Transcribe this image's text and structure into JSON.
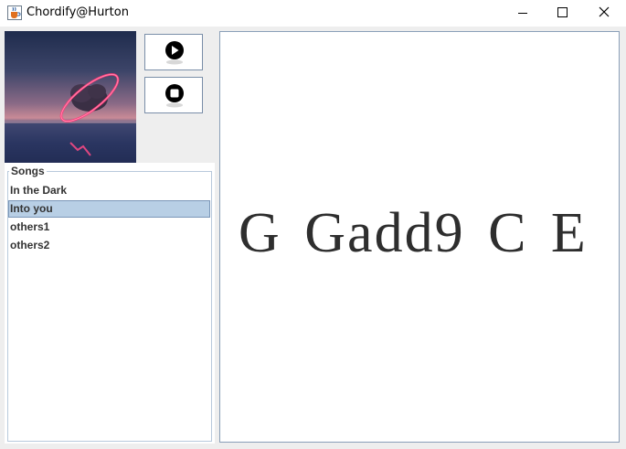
{
  "window": {
    "title": "Chordify@Hurton",
    "icon": "java-cup-icon",
    "controls": [
      "minimize-icon",
      "maximize-icon",
      "close-icon"
    ]
  },
  "player": {
    "play_icon": "play-icon",
    "stop_icon": "stop-icon"
  },
  "songs": {
    "title": "Songs",
    "items": [
      {
        "label": "In the Dark",
        "selected": false
      },
      {
        "label": "Into you",
        "selected": true
      },
      {
        "label": "others1",
        "selected": false
      },
      {
        "label": "others2",
        "selected": false
      }
    ],
    "selection_color": "#b8cfe5"
  },
  "chords": {
    "text": "G Gadd9 C E"
  }
}
